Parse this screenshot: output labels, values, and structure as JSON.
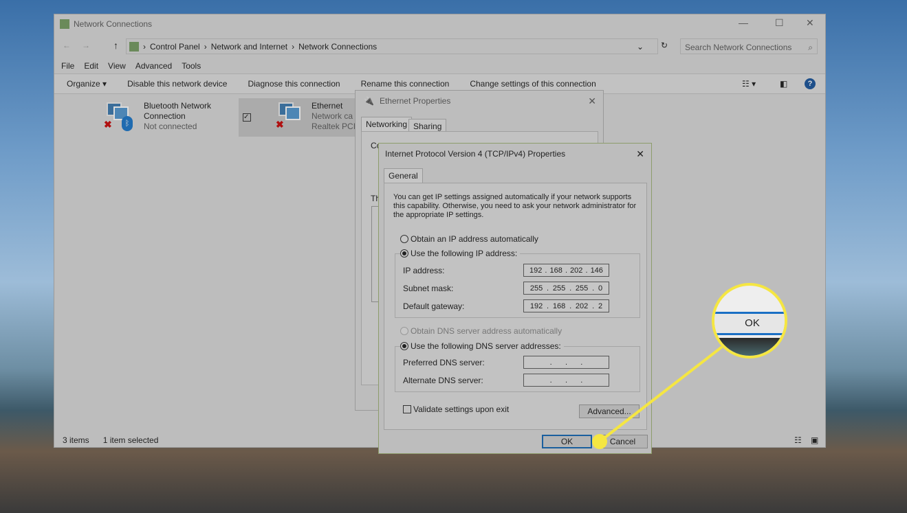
{
  "window": {
    "title": "Network Connections",
    "search_placeholder": "Search Network Connections",
    "breadcrumb": [
      "Control Panel",
      "Network and Internet",
      "Network Connections"
    ],
    "menu": [
      "File",
      "Edit",
      "View",
      "Advanced",
      "Tools"
    ],
    "commands": [
      "Organize ▾",
      "Disable this network device",
      "Diagnose this connection",
      "Rename this connection",
      "Change settings of this connection"
    ],
    "items": [
      {
        "name": "Bluetooth Network",
        "name2": "Connection",
        "status": "Not connected"
      },
      {
        "name": "Ethernet",
        "status": "Network ca",
        "device": "Realtek PCI"
      }
    ],
    "status": {
      "count": "3 items",
      "selected": "1 item selected"
    }
  },
  "ethernet_props": {
    "title": "Ethernet Properties",
    "tabs": [
      "Networking",
      "Sharing"
    ],
    "partial1": "Co",
    "partial2": "Th"
  },
  "ipv4": {
    "title": "Internet Protocol Version 4 (TCP/IPv4) Properties",
    "tab": "General",
    "description": "You can get IP settings assigned automatically if your network supports this capability. Otherwise, you need to ask your network administrator for the appropriate IP settings.",
    "obtain_ip": "Obtain an IP address automatically",
    "use_ip": "Use the following IP address:",
    "ip_label": "IP address:",
    "ip": [
      "192",
      "168",
      "202",
      "146"
    ],
    "mask_label": "Subnet mask:",
    "mask": [
      "255",
      "255",
      "255",
      "0"
    ],
    "gw_label": "Default gateway:",
    "gw": [
      "192",
      "168",
      "202",
      "2"
    ],
    "obtain_dns": "Obtain DNS server address automatically",
    "use_dns": "Use the following DNS server addresses:",
    "pref_dns_label": "Preferred DNS server:",
    "alt_dns_label": "Alternate DNS server:",
    "validate": "Validate settings upon exit",
    "advanced": "Advanced...",
    "ok": "OK",
    "cancel": "Cancel"
  },
  "callout": {
    "label": "OK",
    "color": "#f5e642"
  }
}
